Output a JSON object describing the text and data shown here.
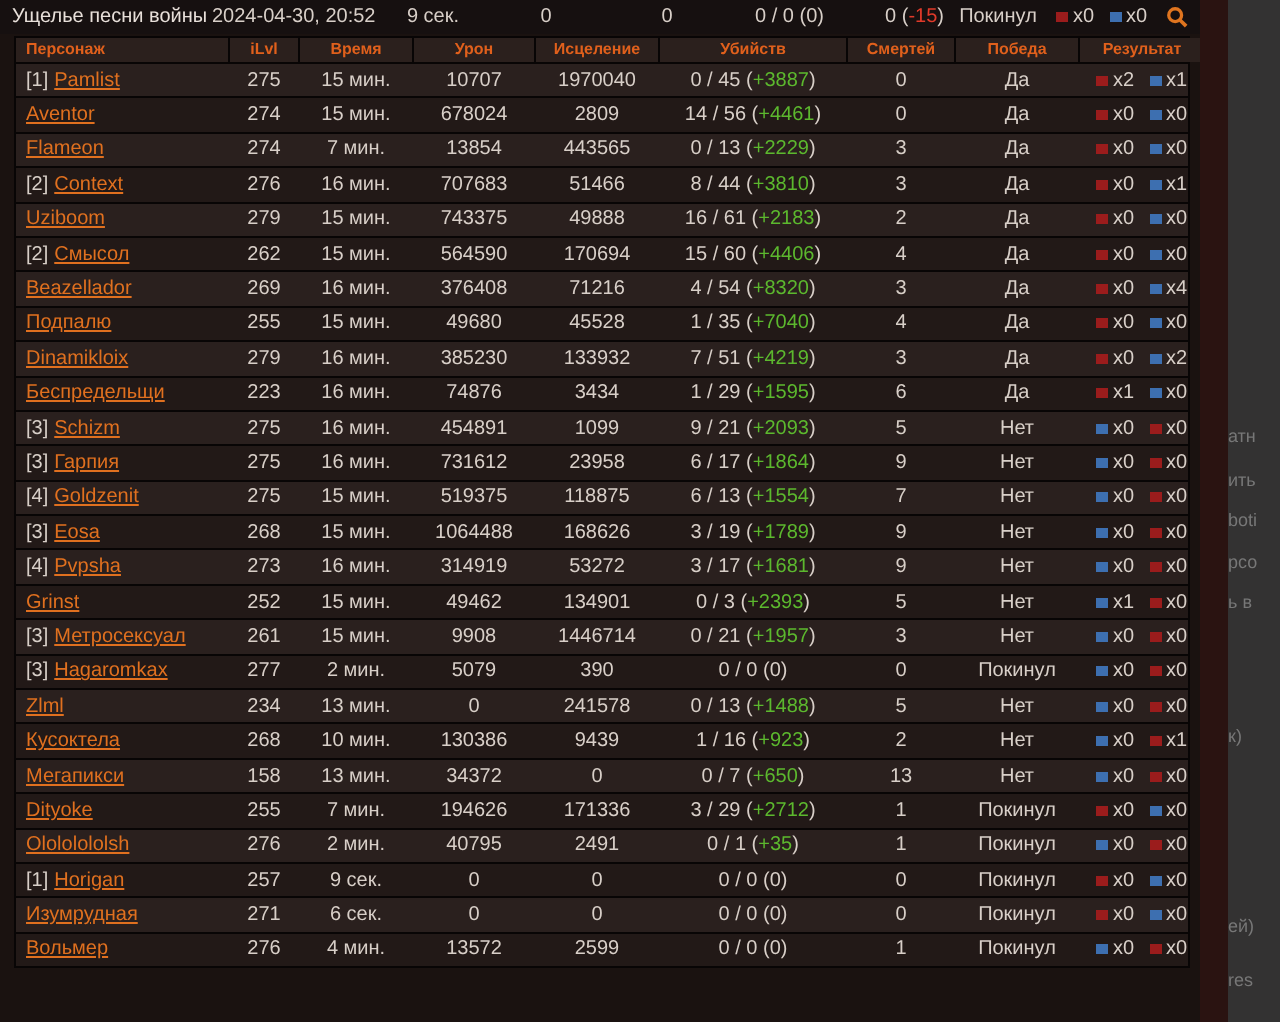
{
  "summary": {
    "battleground": "Ущелье песни войны",
    "date": "2024-04-30, 20:52",
    "time": "9 сек.",
    "damage": "0",
    "healing": "0",
    "kills": "0 / 0",
    "bonus": {
      "text": "(0)",
      "kind": "neutral"
    },
    "deaths": "0",
    "deaths_bonus": {
      "text": "(-15)",
      "kind": "negative"
    },
    "outcome": "Покинул",
    "result": [
      {
        "color": "#9b1c1c",
        "text": "x0"
      },
      {
        "color": "#3d6fb0",
        "text": "x0"
      }
    ]
  },
  "columns": [
    "Персонаж",
    "iLvl",
    "Время",
    "Урон",
    "Исцеление",
    "Убийств",
    "Смертей",
    "Победа",
    "Результат"
  ],
  "rows": [
    {
      "group": "[1]",
      "name": "Pamlist",
      "ilvl": "275",
      "time": "15 мин.",
      "damage": "10707",
      "healing": "1970040",
      "kills": "0 / 45",
      "bonus": {
        "text": "(+3887)",
        "kind": "positive"
      },
      "deaths": "0",
      "win": "Да",
      "result": [
        {
          "color": "#9b1c1c",
          "text": "x2"
        },
        {
          "color": "#3d6fb0",
          "text": "x1"
        }
      ]
    },
    {
      "name": "Aventor",
      "ilvl": "274",
      "time": "15 мин.",
      "damage": "678024",
      "healing": "2809",
      "kills": "14 / 56",
      "bonus": {
        "text": "(+4461)",
        "kind": "positive"
      },
      "deaths": "0",
      "win": "Да",
      "result": [
        {
          "color": "#9b1c1c",
          "text": "x0"
        },
        {
          "color": "#3d6fb0",
          "text": "x0"
        }
      ]
    },
    {
      "name": "Flameon",
      "ilvl": "274",
      "time": "7 мин.",
      "damage": "13854",
      "healing": "443565",
      "kills": "0 / 13",
      "bonus": {
        "text": "(+2229)",
        "kind": "positive"
      },
      "deaths": "3",
      "win": "Да",
      "result": [
        {
          "color": "#9b1c1c",
          "text": "x0"
        },
        {
          "color": "#3d6fb0",
          "text": "x0"
        }
      ]
    },
    {
      "group": "[2]",
      "name": "Context",
      "ilvl": "276",
      "time": "16 мин.",
      "damage": "707683",
      "healing": "51466",
      "kills": "8 / 44",
      "bonus": {
        "text": "(+3810)",
        "kind": "positive"
      },
      "deaths": "3",
      "win": "Да",
      "result": [
        {
          "color": "#9b1c1c",
          "text": "x0"
        },
        {
          "color": "#3d6fb0",
          "text": "x1"
        }
      ]
    },
    {
      "name": "Uziboom",
      "ilvl": "279",
      "time": "15 мин.",
      "damage": "743375",
      "healing": "49888",
      "kills": "16 / 61",
      "bonus": {
        "text": "(+2183)",
        "kind": "positive"
      },
      "deaths": "2",
      "win": "Да",
      "result": [
        {
          "color": "#9b1c1c",
          "text": "x0"
        },
        {
          "color": "#3d6fb0",
          "text": "x0"
        }
      ]
    },
    {
      "group": "[2]",
      "name": "Смысол",
      "ilvl": "262",
      "time": "15 мин.",
      "damage": "564590",
      "healing": "170694",
      "kills": "15 / 60",
      "bonus": {
        "text": "(+4406)",
        "kind": "positive"
      },
      "deaths": "4",
      "win": "Да",
      "result": [
        {
          "color": "#9b1c1c",
          "text": "x0"
        },
        {
          "color": "#3d6fb0",
          "text": "x0"
        }
      ]
    },
    {
      "name": "Beazellador",
      "ilvl": "269",
      "time": "16 мин.",
      "damage": "376408",
      "healing": "71216",
      "kills": "4 / 54",
      "bonus": {
        "text": "(+8320)",
        "kind": "positive"
      },
      "deaths": "3",
      "win": "Да",
      "result": [
        {
          "color": "#9b1c1c",
          "text": "x0"
        },
        {
          "color": "#3d6fb0",
          "text": "x4"
        }
      ]
    },
    {
      "name": "Подпалю",
      "ilvl": "255",
      "time": "15 мин.",
      "damage": "49680",
      "healing": "45528",
      "kills": "1 / 35",
      "bonus": {
        "text": "(+7040)",
        "kind": "positive"
      },
      "deaths": "4",
      "win": "Да",
      "result": [
        {
          "color": "#9b1c1c",
          "text": "x0"
        },
        {
          "color": "#3d6fb0",
          "text": "x0"
        }
      ]
    },
    {
      "name": "Dinamikloix",
      "ilvl": "279",
      "time": "16 мин.",
      "damage": "385230",
      "healing": "133932",
      "kills": "7 / 51",
      "bonus": {
        "text": "(+4219)",
        "kind": "positive"
      },
      "deaths": "3",
      "win": "Да",
      "result": [
        {
          "color": "#9b1c1c",
          "text": "x0"
        },
        {
          "color": "#3d6fb0",
          "text": "x2"
        }
      ]
    },
    {
      "name": "Беспредельщи",
      "ilvl": "223",
      "time": "16 мин.",
      "damage": "74876",
      "healing": "3434",
      "kills": "1 / 29",
      "bonus": {
        "text": "(+1595)",
        "kind": "positive"
      },
      "deaths": "6",
      "win": "Да",
      "result": [
        {
          "color": "#9b1c1c",
          "text": "x1"
        },
        {
          "color": "#3d6fb0",
          "text": "x0"
        }
      ]
    },
    {
      "group": "[3]",
      "name": "Schizm",
      "ilvl": "275",
      "time": "16 мин.",
      "damage": "454891",
      "healing": "1099",
      "kills": "9 / 21",
      "bonus": {
        "text": "(+2093)",
        "kind": "positive"
      },
      "deaths": "5",
      "win": "Нет",
      "result": [
        {
          "color": "#3d6fb0",
          "text": "x0"
        },
        {
          "color": "#9b1c1c",
          "text": "x0"
        }
      ]
    },
    {
      "group": "[3]",
      "name": "Гарпия",
      "ilvl": "275",
      "time": "16 мин.",
      "damage": "731612",
      "healing": "23958",
      "kills": "6 / 17",
      "bonus": {
        "text": "(+1864)",
        "kind": "positive"
      },
      "deaths": "9",
      "win": "Нет",
      "result": [
        {
          "color": "#3d6fb0",
          "text": "x0"
        },
        {
          "color": "#9b1c1c",
          "text": "x0"
        }
      ]
    },
    {
      "group": "[4]",
      "name": "Goldzenit",
      "ilvl": "275",
      "time": "15 мин.",
      "damage": "519375",
      "healing": "118875",
      "kills": "6 / 13",
      "bonus": {
        "text": "(+1554)",
        "kind": "positive"
      },
      "deaths": "7",
      "win": "Нет",
      "result": [
        {
          "color": "#3d6fb0",
          "text": "x0"
        },
        {
          "color": "#9b1c1c",
          "text": "x0"
        }
      ]
    },
    {
      "group": "[3]",
      "name": "Eosa",
      "ilvl": "268",
      "time": "15 мин.",
      "damage": "1064488",
      "healing": "168626",
      "kills": "3 / 19",
      "bonus": {
        "text": "(+1789)",
        "kind": "positive"
      },
      "deaths": "9",
      "win": "Нет",
      "result": [
        {
          "color": "#3d6fb0",
          "text": "x0"
        },
        {
          "color": "#9b1c1c",
          "text": "x0"
        }
      ]
    },
    {
      "group": "[4]",
      "name": "Pvpsha",
      "ilvl": "273",
      "time": "16 мин.",
      "damage": "314919",
      "healing": "53272",
      "kills": "3 / 17",
      "bonus": {
        "text": "(+1681)",
        "kind": "positive"
      },
      "deaths": "9",
      "win": "Нет",
      "result": [
        {
          "color": "#3d6fb0",
          "text": "x0"
        },
        {
          "color": "#9b1c1c",
          "text": "x0"
        }
      ]
    },
    {
      "name": "Grinst",
      "ilvl": "252",
      "time": "15 мин.",
      "damage": "49462",
      "healing": "134901",
      "kills": "0 / 3",
      "bonus": {
        "text": "(+2393)",
        "kind": "positive"
      },
      "deaths": "5",
      "win": "Нет",
      "result": [
        {
          "color": "#3d6fb0",
          "text": "x1"
        },
        {
          "color": "#9b1c1c",
          "text": "x0"
        }
      ]
    },
    {
      "group": "[3]",
      "name": "Метросексуал",
      "ilvl": "261",
      "time": "15 мин.",
      "damage": "9908",
      "healing": "1446714",
      "kills": "0 / 21",
      "bonus": {
        "text": "(+1957)",
        "kind": "positive"
      },
      "deaths": "3",
      "win": "Нет",
      "result": [
        {
          "color": "#3d6fb0",
          "text": "x0"
        },
        {
          "color": "#9b1c1c",
          "text": "x0"
        }
      ]
    },
    {
      "group": "[3]",
      "name": "Hagaromkax",
      "ilvl": "277",
      "time": "2 мин.",
      "damage": "5079",
      "healing": "390",
      "kills": "0 / 0",
      "bonus": {
        "text": "(0)",
        "kind": "neutral"
      },
      "deaths": "0",
      "win": "Покинул",
      "result": [
        {
          "color": "#3d6fb0",
          "text": "x0"
        },
        {
          "color": "#9b1c1c",
          "text": "x0"
        }
      ]
    },
    {
      "name": "Zlml",
      "ilvl": "234",
      "time": "13 мин.",
      "damage": "0",
      "healing": "241578",
      "kills": "0 / 13",
      "bonus": {
        "text": "(+1488)",
        "kind": "positive"
      },
      "deaths": "5",
      "win": "Нет",
      "result": [
        {
          "color": "#3d6fb0",
          "text": "x0"
        },
        {
          "color": "#9b1c1c",
          "text": "x0"
        }
      ]
    },
    {
      "name": "Кусоктела",
      "ilvl": "268",
      "time": "10 мин.",
      "damage": "130386",
      "healing": "9439",
      "kills": "1 / 16",
      "bonus": {
        "text": "(+923)",
        "kind": "positive"
      },
      "deaths": "2",
      "win": "Нет",
      "result": [
        {
          "color": "#3d6fb0",
          "text": "x0"
        },
        {
          "color": "#9b1c1c",
          "text": "x1"
        }
      ]
    },
    {
      "name": "Мегапикси",
      "ilvl": "158",
      "time": "13 мин.",
      "damage": "34372",
      "healing": "0",
      "kills": "0 / 7",
      "bonus": {
        "text": "(+650)",
        "kind": "positive"
      },
      "deaths": "13",
      "win": "Нет",
      "result": [
        {
          "color": "#3d6fb0",
          "text": "x0"
        },
        {
          "color": "#9b1c1c",
          "text": "x0"
        }
      ]
    },
    {
      "name": "Dityoke",
      "ilvl": "255",
      "time": "7 мин.",
      "damage": "194626",
      "healing": "171336",
      "kills": "3 / 29",
      "bonus": {
        "text": "(+2712)",
        "kind": "positive"
      },
      "deaths": "1",
      "win": "Покинул",
      "result": [
        {
          "color": "#9b1c1c",
          "text": "x0"
        },
        {
          "color": "#3d6fb0",
          "text": "x0"
        }
      ]
    },
    {
      "name": "Olololololsh",
      "ilvl": "276",
      "time": "2 мин.",
      "damage": "40795",
      "healing": "2491",
      "kills": "0 / 1",
      "bonus": {
        "text": "(+35)",
        "kind": "positive"
      },
      "deaths": "1",
      "win": "Покинул",
      "result": [
        {
          "color": "#3d6fb0",
          "text": "x0"
        },
        {
          "color": "#9b1c1c",
          "text": "x0"
        }
      ]
    },
    {
      "group": "[1]",
      "name": "Horigan",
      "ilvl": "257",
      "time": "9 сек.",
      "damage": "0",
      "healing": "0",
      "kills": "0 / 0",
      "bonus": {
        "text": "(0)",
        "kind": "neutral"
      },
      "deaths": "0",
      "win": "Покинул",
      "result": [
        {
          "color": "#9b1c1c",
          "text": "x0"
        },
        {
          "color": "#3d6fb0",
          "text": "x0"
        }
      ]
    },
    {
      "name": "Изумрудная",
      "ilvl": "271",
      "time": "6 сек.",
      "damage": "0",
      "healing": "0",
      "kills": "0 / 0",
      "bonus": {
        "text": "(0)",
        "kind": "neutral"
      },
      "deaths": "0",
      "win": "Покинул",
      "result": [
        {
          "color": "#9b1c1c",
          "text": "x0"
        },
        {
          "color": "#3d6fb0",
          "text": "x0"
        }
      ]
    },
    {
      "name": "Вольмер",
      "ilvl": "276",
      "time": "4 мин.",
      "damage": "13572",
      "healing": "2599",
      "kills": "0 / 0",
      "bonus": {
        "text": "(0)",
        "kind": "neutral"
      },
      "deaths": "1",
      "win": "Покинул",
      "result": [
        {
          "color": "#3d6fb0",
          "text": "x0"
        },
        {
          "color": "#9b1c1c",
          "text": "x0"
        }
      ]
    }
  ],
  "background_fragments": [
    "атн",
    "ить",
    "boti",
    "рсо",
    "ь в",
    "к)",
    "ей)",
    "res"
  ]
}
